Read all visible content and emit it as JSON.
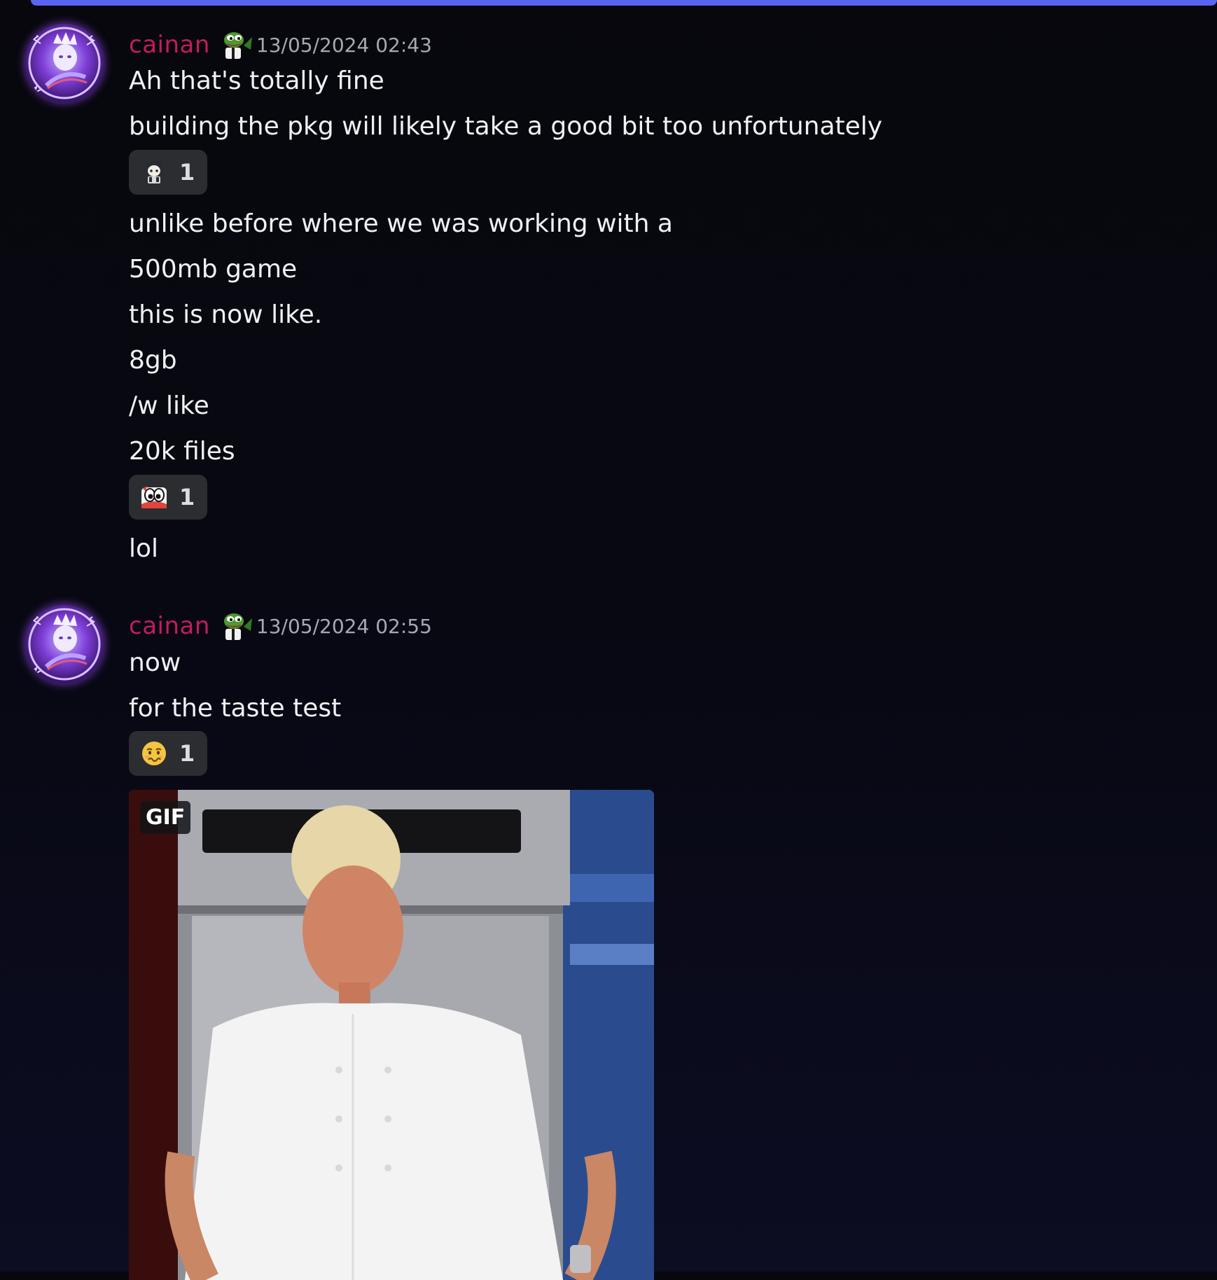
{
  "messages": [
    {
      "username": "cainan",
      "timestamp": "13/05/2024 02:43",
      "lines": [
        "Ah that's totally fine",
        "building the pkg will likely take a good bit too unfortunately",
        "unlike before where we was working with a",
        "500mb game",
        "this is now like.",
        "8gb",
        "/w like",
        "20k files",
        "lol"
      ],
      "reactions": [
        {
          "emoji": "anime-character-emoji",
          "count": "1"
        },
        {
          "emoji": "googly-eyes-emoji",
          "count": "1"
        }
      ]
    },
    {
      "username": "cainan",
      "timestamp": "13/05/2024 02:55",
      "lines": [
        "now",
        "for the taste test"
      ],
      "reactions": [
        {
          "emoji": "woozy-face-emoji",
          "count": "1"
        }
      ],
      "attachment": {
        "type": "gif",
        "badge": "GIF"
      }
    }
  ],
  "colors": {
    "accent_bar": "#5865f2",
    "username": "#c21d5c",
    "timestamp": "#a6a8b3",
    "reaction_bg": "#2b2d31"
  }
}
